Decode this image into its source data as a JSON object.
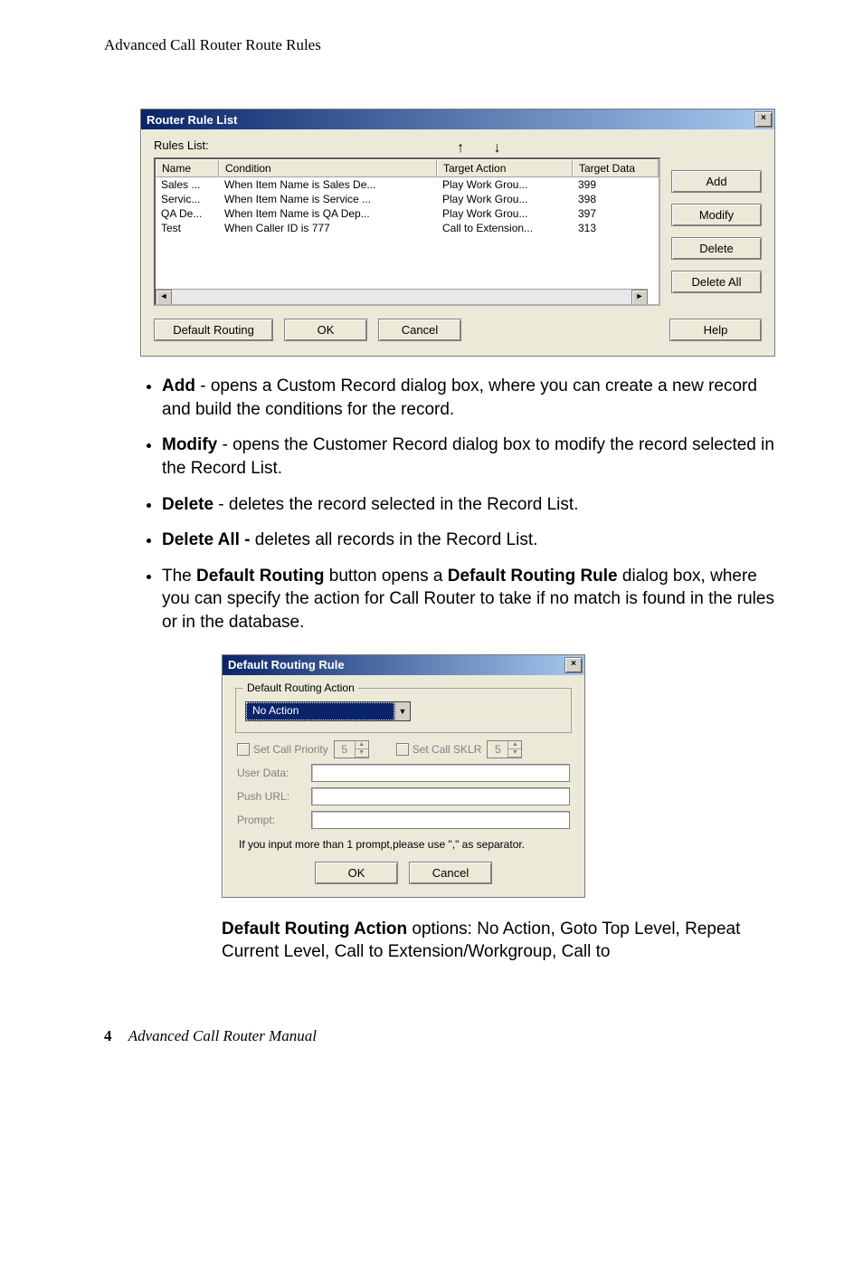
{
  "running_head": "Advanced Call Router Route Rules",
  "dialog1": {
    "title": "Router Rule List",
    "close": "×",
    "rules_label": "Rules List:",
    "headers": {
      "name": "Name",
      "condition": "Condition",
      "target_action": "Target Action",
      "target_data": "Target Data"
    },
    "rows": [
      {
        "name": "Sales ...",
        "condition": "When Item Name is Sales De...",
        "action": "Play Work Grou...",
        "data": "399"
      },
      {
        "name": "Servic...",
        "condition": "When Item Name is Service ...",
        "action": "Play Work Grou...",
        "data": "398"
      },
      {
        "name": "QA De...",
        "condition": "When Item Name is QA Dep...",
        "action": "Play Work Grou...",
        "data": "397"
      },
      {
        "name": "Test",
        "condition": "When Caller ID is 777",
        "action": "Call to Extension...",
        "data": "313"
      }
    ],
    "buttons": {
      "add": "Add",
      "modify": "Modify",
      "delete": "Delete",
      "delete_all": "Delete All",
      "default_routing": "Default Routing",
      "ok": "OK",
      "cancel": "Cancel",
      "help": "Help"
    }
  },
  "bullets": {
    "b1_label": "Add",
    "b1_text": " - opens a Custom Record dialog box, where you can create a new record and build the conditions for the record.",
    "b2_label": "Modify",
    "b2_text": " - opens the Customer Record dialog box to modify the record selected in the Record List.",
    "b3_label": "Delete",
    "b3_text": " - deletes the record selected in the Record List.",
    "b4_label": "Delete All -",
    "b4_text": " deletes all records in the Record List.",
    "b5_pre": "The ",
    "b5_label1": "Default Routing",
    "b5_mid": " button opens a ",
    "b5_label2": "Default Routing Rule",
    "b5_text": " dialog box, where you can specify the action for Call Router to take if no match is found in the rules or in the database."
  },
  "dialog2": {
    "title": "Default Routing Rule",
    "close": "×",
    "group_title": "Default Routing Action",
    "combo_value": "No Action",
    "set_priority": "Set Call Priority",
    "priority_val": "5",
    "set_sklr": "Set Call SKLR",
    "sklr_val": "5",
    "user_data": "User Data:",
    "push_url": "Push URL:",
    "prompt": "Prompt:",
    "hint": "If you input more than 1 prompt,please use \",\" as separator.",
    "ok": "OK",
    "cancel": "Cancel"
  },
  "caption": {
    "bold": "Default Routing Action",
    "rest": " options: No Action, Goto Top Level, Repeat Current Level, Call to Extension/Workgroup, Call to"
  },
  "footer": {
    "page": "4",
    "manual": "Advanced Call Router Manual"
  }
}
